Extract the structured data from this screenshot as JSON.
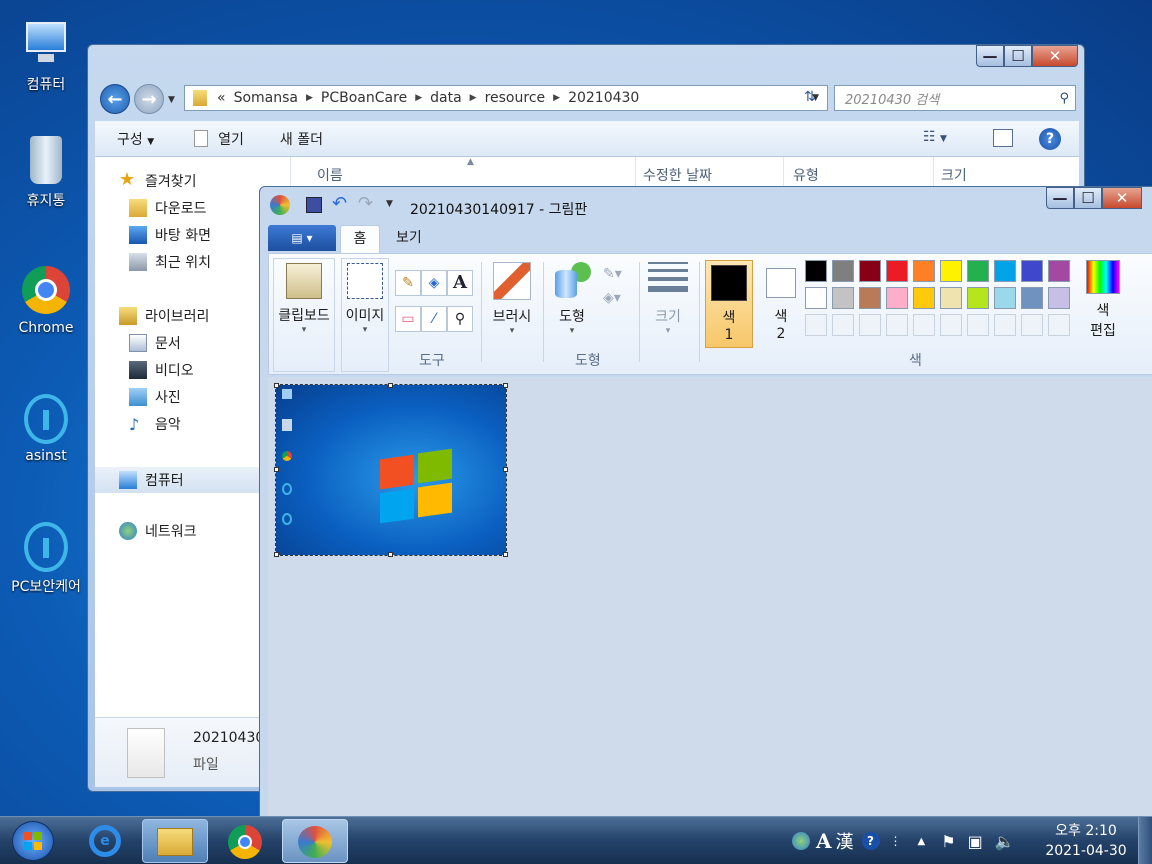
{
  "desktop": {
    "icons": [
      {
        "label": "컴퓨터"
      },
      {
        "label": "휴지통"
      },
      {
        "label": "Chrome"
      },
      {
        "label": "asinst"
      },
      {
        "label": "PC보안케어"
      }
    ]
  },
  "explorer": {
    "address_prefix": "«",
    "breadcrumb": [
      "Somansa",
      "PCBoanCare",
      "data",
      "resource",
      "20210430"
    ],
    "search_placeholder": "20210430 검색",
    "toolbar": {
      "organize": "구성",
      "open": "열기",
      "new_folder": "새 폴더"
    },
    "nav": {
      "favorites": "즐겨찾기",
      "downloads": "다운로드",
      "desktop": "바탕 화면",
      "recent": "최근 위치",
      "libraries": "라이브러리",
      "documents": "문서",
      "videos": "비디오",
      "pictures": "사진",
      "music": "음악",
      "computer": "컴퓨터",
      "network": "네트워크"
    },
    "columns": {
      "name": "이름",
      "date": "수정한 날짜",
      "type": "유형",
      "size": "크기"
    },
    "details": {
      "filename": "20210430",
      "filetype": "파일"
    }
  },
  "paint": {
    "title": "20210430140917 - 그림판",
    "tabs": {
      "home": "홈",
      "view": "보기"
    },
    "groups": {
      "clipboard": "클립보드",
      "image": "이미지",
      "tools": "도구",
      "brushes": "브러시",
      "shapes_btn": "도형",
      "shapes_group": "도형",
      "size": "크기",
      "color1_a": "색",
      "color1_b": "1",
      "color2_a": "색",
      "color2_b": "2",
      "colors_group": "색",
      "edit_colors_a": "색",
      "edit_colors_b": "편집"
    },
    "palette_row1": [
      "#000000",
      "#7f7f7f",
      "#880015",
      "#ed1c24",
      "#ff7f27",
      "#fff200",
      "#22b14c",
      "#00a2e8",
      "#3f48cc",
      "#a349a4"
    ],
    "palette_row2": [
      "#ffffff",
      "#c3c3c3",
      "#b97a57",
      "#ffaec9",
      "#ffc90e",
      "#efe4b0",
      "#b5e61d",
      "#99d9ea",
      "#7092be",
      "#c8bfe7"
    ],
    "color1": "#000000",
    "color2": "#ffffff"
  },
  "taskbar": {
    "clock_time": "오후 2:10",
    "clock_date": "2021-04-30",
    "ime_a": "A",
    "ime_han": "漢"
  }
}
